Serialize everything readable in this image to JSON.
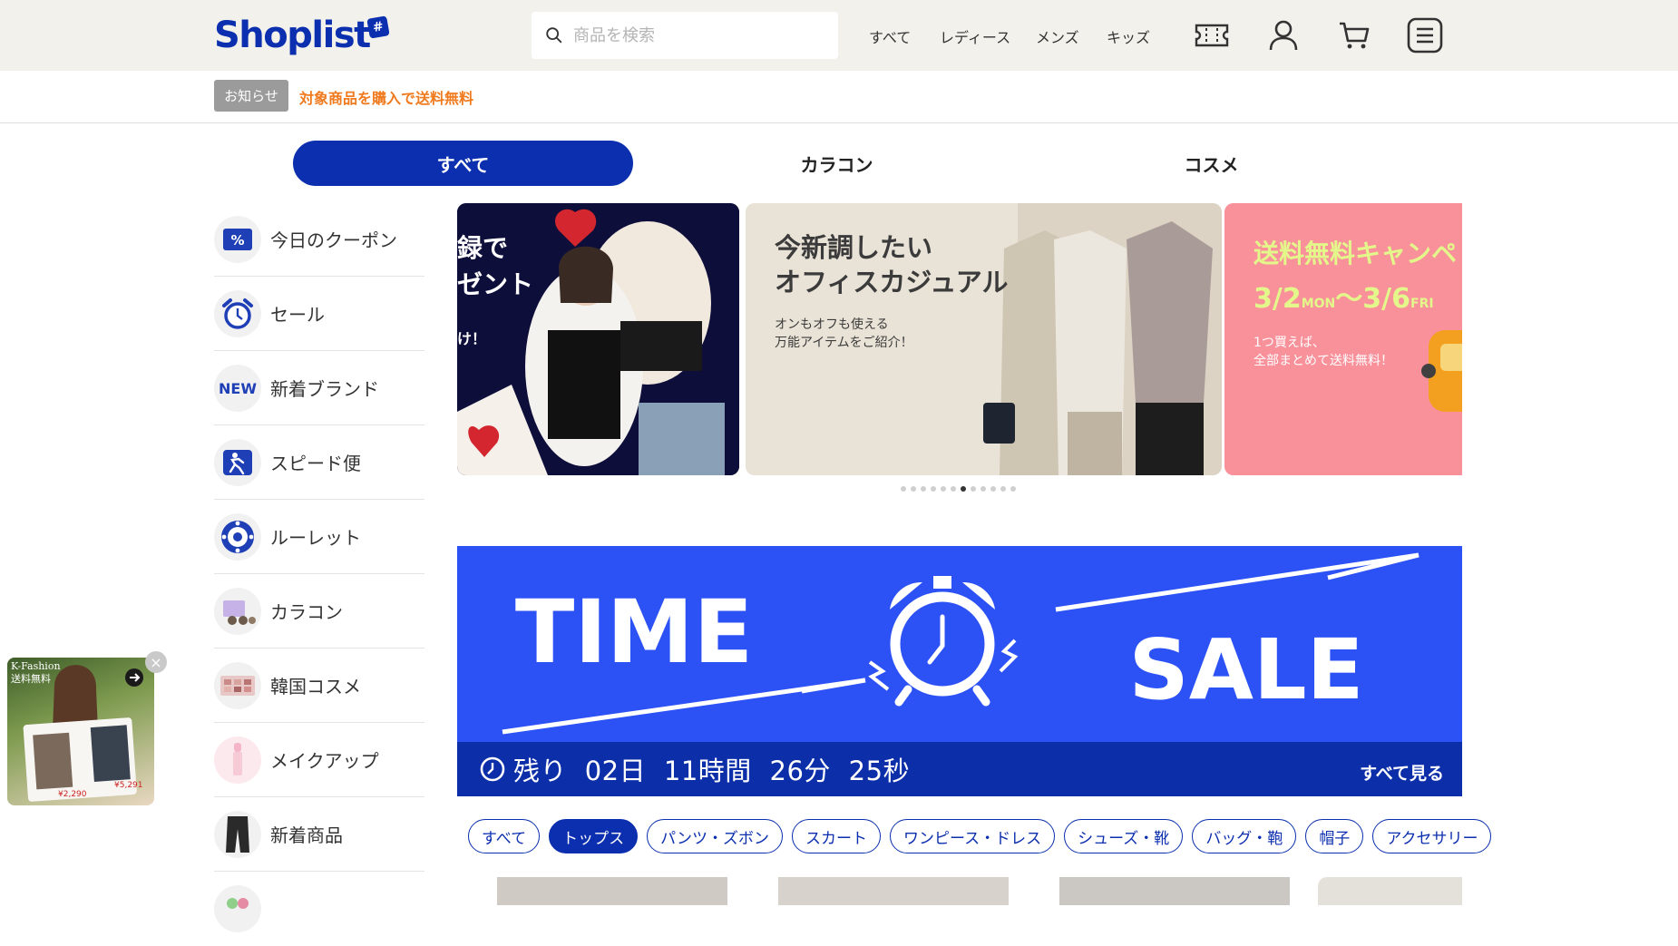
{
  "header": {
    "logo_text": "Shoplist",
    "logo_tag": "#",
    "search_placeholder": "商品を検索",
    "nav": [
      "すべて",
      "レディース",
      "メンズ",
      "キッズ"
    ]
  },
  "notice": {
    "badge": "お知らせ",
    "text": "対象商品を購入で送料無料"
  },
  "tabs": [
    {
      "label": "すべて",
      "active": true
    },
    {
      "label": "カラコン",
      "active": false
    },
    {
      "label": "コスメ",
      "active": false
    }
  ],
  "sidebar": [
    {
      "label": "今日のクーポン",
      "icon": "coupon-percent-icon"
    },
    {
      "label": "セール",
      "icon": "alarm-clock-icon"
    },
    {
      "label": "新着ブランド",
      "icon": "new-badge-icon"
    },
    {
      "label": "スピード便",
      "icon": "running-person-icon"
    },
    {
      "label": "ルーレット",
      "icon": "roulette-icon"
    },
    {
      "label": "カラコン",
      "icon": "contact-lens-icon"
    },
    {
      "label": "韓国コスメ",
      "icon": "eyeshadow-palette-icon"
    },
    {
      "label": "メイクアップ",
      "icon": "lipstick-icon"
    },
    {
      "label": "新着商品",
      "icon": "pants-icon"
    },
    {
      "label": "",
      "icon": "partial-icon"
    }
  ],
  "banners": {
    "b1": {
      "line1": "録で",
      "line2": "ゼント",
      "line3": "け！"
    },
    "b2": {
      "title1": "今新調したい",
      "title2": "オフィスカジュアル",
      "sub1": "オンもオフも使える",
      "sub2": "万能アイテムをご紹介！"
    },
    "b3": {
      "title": "送料無料キャンペ",
      "d1": "3/2",
      "dw1": "MON",
      "sep": "〜",
      "d2": "3/6",
      "dw2": "FRI",
      "sub1": "1つ買えば、",
      "sub2": "全部まとめて送料無料！"
    },
    "dots_total": 12,
    "dots_active": 6
  },
  "time_sale": {
    "word1": "TIME",
    "word2": "SALE",
    "remaining_label": "残り",
    "days": "02",
    "days_unit": "日",
    "hours": "11",
    "hours_unit": "時間",
    "minutes": "26",
    "minutes_unit": "分",
    "seconds": "25",
    "seconds_unit": "秒",
    "see_all": "すべて見る"
  },
  "chips": [
    {
      "label": "すべて",
      "on": false
    },
    {
      "label": "トップス",
      "on": true
    },
    {
      "label": "パンツ・ズボン",
      "on": false
    },
    {
      "label": "スカート",
      "on": false
    },
    {
      "label": "ワンピース・ドレス",
      "on": false
    },
    {
      "label": "シューズ・靴",
      "on": false
    },
    {
      "label": "バッグ・鞄",
      "on": false
    },
    {
      "label": "帽子",
      "on": false
    },
    {
      "label": "アクセサリー",
      "on": false
    }
  ],
  "float_ad": {
    "tag1": "K-Fashion",
    "tag2": "送料無料",
    "price1": "¥2,290",
    "price2": "¥5,291"
  },
  "colors": {
    "brand": "#0b2fae",
    "sale_blue": "#2c52f5",
    "notice_orange": "#f07a1e"
  }
}
